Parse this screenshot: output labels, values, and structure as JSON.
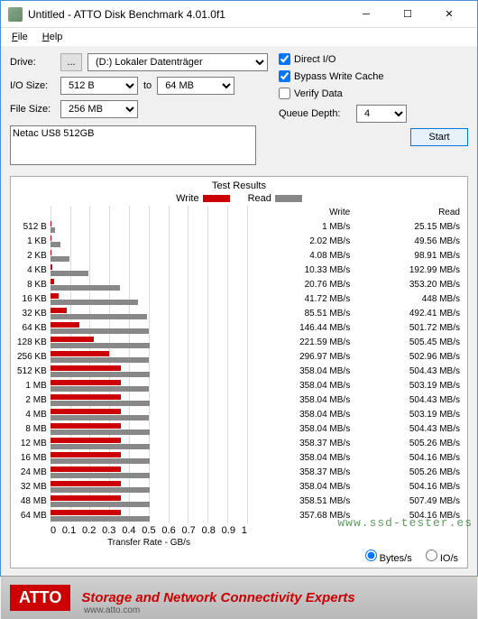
{
  "window": {
    "title": "Untitled - ATTO Disk Benchmark 4.01.0f1"
  },
  "menu": {
    "file": "File",
    "help": "Help"
  },
  "form": {
    "drive_lbl": "Drive:",
    "drive_btn": "...",
    "drive_val": "(D:) Lokaler Datenträger",
    "io_lbl": "I/O Size:",
    "io_from": "512 B",
    "to": "to",
    "io_to": "64 MB",
    "fs_lbl": "File Size:",
    "fs_val": "256 MB",
    "direct": "Direct I/O",
    "bypass": "Bypass Write Cache",
    "verify": "Verify Data",
    "qd_lbl": "Queue Depth:",
    "qd_val": "4",
    "start": "Start",
    "device": "Netac US8 512GB"
  },
  "results_title": "Test Results",
  "legend": {
    "write": "Write",
    "read": "Read"
  },
  "headers": {
    "write": "Write",
    "read": "Read"
  },
  "units": {
    "bytes": "Bytes/s",
    "ios": "IO/s"
  },
  "xlabel": "Transfer Rate - GB/s",
  "xticks": [
    "0",
    "0.1",
    "0.2",
    "0.3",
    "0.4",
    "0.5",
    "0.6",
    "0.7",
    "0.8",
    "0.9",
    "1"
  ],
  "footer": {
    "logo": "ATTO",
    "tag": "Storage and Network Connectivity Experts",
    "url": "www.atto.com"
  },
  "watermark": "www.ssd-tester.es",
  "chart_data": {
    "type": "bar",
    "xlabel": "Transfer Rate - GB/s",
    "xlim": [
      0,
      1
    ],
    "categories": [
      "512 B",
      "1 KB",
      "2 KB",
      "4 KB",
      "8 KB",
      "16 KB",
      "32 KB",
      "64 KB",
      "128 KB",
      "256 KB",
      "512 KB",
      "1 MB",
      "2 MB",
      "4 MB",
      "8 MB",
      "12 MB",
      "16 MB",
      "24 MB",
      "32 MB",
      "48 MB",
      "64 MB"
    ],
    "series": [
      {
        "name": "Write",
        "unit": "MB/s",
        "values": [
          1,
          2.02,
          4.08,
          10.33,
          20.76,
          41.72,
          85.51,
          146.44,
          221.59,
          296.97,
          358.04,
          358.04,
          358.04,
          358.04,
          358.04,
          358.37,
          358.04,
          358.37,
          358.04,
          358.51,
          357.68
        ],
        "labels": [
          "1 MB/s",
          "2.02 MB/s",
          "4.08 MB/s",
          "10.33 MB/s",
          "20.76 MB/s",
          "41.72 MB/s",
          "85.51 MB/s",
          "146.44 MB/s",
          "221.59 MB/s",
          "296.97 MB/s",
          "358.04 MB/s",
          "358.04 MB/s",
          "358.04 MB/s",
          "358.04 MB/s",
          "358.04 MB/s",
          "358.37 MB/s",
          "358.04 MB/s",
          "358.37 MB/s",
          "358.04 MB/s",
          "358.51 MB/s",
          "357.68 MB/s"
        ]
      },
      {
        "name": "Read",
        "unit": "MB/s",
        "values": [
          25.15,
          49.56,
          98.91,
          192.99,
          353.2,
          448,
          492.41,
          501.72,
          505.45,
          502.96,
          504.43,
          503.19,
          504.43,
          503.19,
          504.43,
          505.26,
          504.16,
          505.26,
          504.16,
          507.49,
          504.16
        ],
        "labels": [
          "25.15 MB/s",
          "49.56 MB/s",
          "98.91 MB/s",
          "192.99 MB/s",
          "353.20 MB/s",
          "448 MB/s",
          "492.41 MB/s",
          "501.72 MB/s",
          "505.45 MB/s",
          "502.96 MB/s",
          "504.43 MB/s",
          "503.19 MB/s",
          "504.43 MB/s",
          "503.19 MB/s",
          "504.43 MB/s",
          "505.26 MB/s",
          "504.16 MB/s",
          "505.26 MB/s",
          "504.16 MB/s",
          "507.49 MB/s",
          "504.16 MB/s"
        ]
      }
    ]
  }
}
